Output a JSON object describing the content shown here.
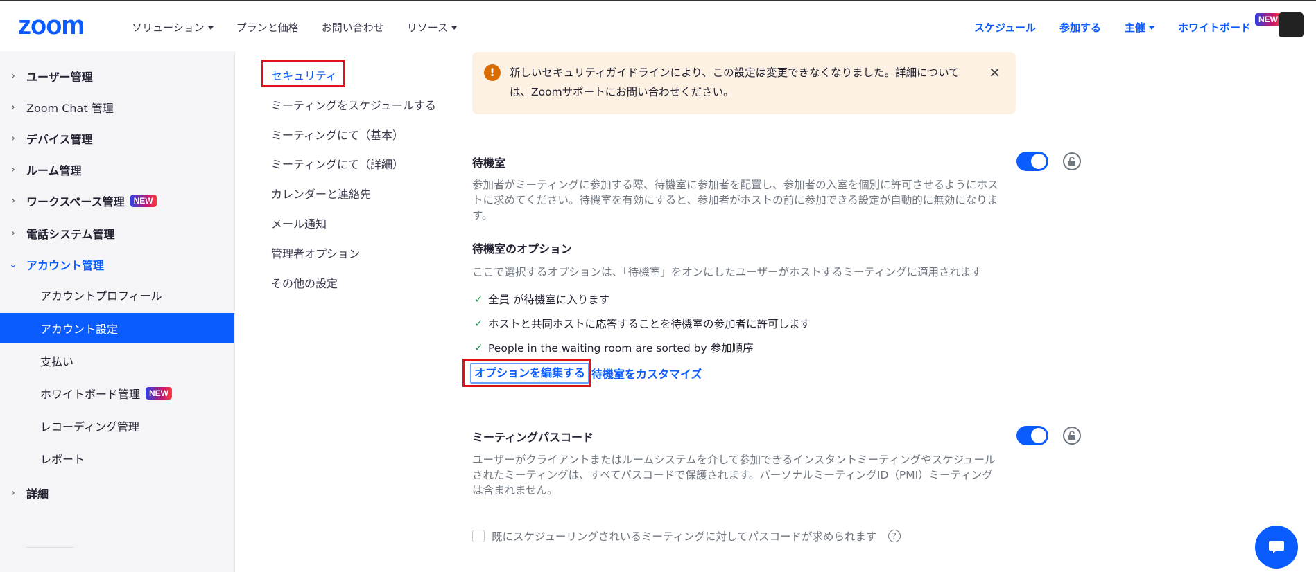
{
  "header": {
    "logo": "zoom",
    "nav_left": [
      {
        "label": "ソリューション",
        "has_caret": true
      },
      {
        "label": "プランと価格",
        "has_caret": false
      },
      {
        "label": "お問い合わせ",
        "has_caret": false
      },
      {
        "label": "リソース",
        "has_caret": true
      }
    ],
    "nav_right": {
      "schedule": "スケジュール",
      "join": "参加する",
      "host": "主催",
      "whiteboard": "ホワイトボード",
      "new_badge": "NEW"
    }
  },
  "sidebar": {
    "items": [
      {
        "label": "ユーザー管理"
      },
      {
        "label": "Zoom Chat 管理"
      },
      {
        "label": "デバイス管理"
      },
      {
        "label": "ルーム管理"
      },
      {
        "label": "ワークスペース管理",
        "badge": "NEW"
      },
      {
        "label": "電話システム管理"
      },
      {
        "label": "アカウント管理"
      }
    ],
    "subitems": [
      {
        "label": "アカウントプロフィール"
      },
      {
        "label": "アカウント設定"
      },
      {
        "label": "支払い"
      },
      {
        "label": "ホワイトボード管理",
        "badge": "NEW"
      },
      {
        "label": "レコーディング管理"
      },
      {
        "label": "レポート"
      }
    ],
    "advanced": "詳細"
  },
  "settings_nav": [
    "セキュリティ",
    "ミーティングをスケジュールする",
    "ミーティングにて（基本）",
    "ミーティングにて（詳細）",
    "カレンダーと連絡先",
    "メール通知",
    "管理者オプション",
    "その他の設定"
  ],
  "notice": {
    "message": "新しいセキュリティガイドラインにより、この設定は変更できなくなりました。詳細については、Zoomサポートにお問い合わせください。"
  },
  "waiting_room": {
    "title": "待機室",
    "description": "参加者がミーティングに参加する際、待機室に参加者を配置し、参加者の入室を個別に許可させるようにホストに求めてください。待機室を有効にすると、参加者がホストの前に参加できる設定が自動的に無効になります。",
    "enabled": true,
    "options_title": "待機室のオプション",
    "options_desc": "ここで選択するオプションは、「待機室」をオンにしたユーザーがホストするミーティングに適用されます",
    "options": [
      "全員 が待機室に入ります",
      "ホストと共同ホストに応答することを待機室の参加者に許可します",
      "People in the waiting room are sorted by 参加順序"
    ],
    "edit_options": "オプションを編集する",
    "customize": "待機室をカスタマイズ"
  },
  "meeting_passcode": {
    "title": "ミーティングパスコード",
    "description": "ユーザーがクライアントまたはルームシステムを介して参加できるインスタントミーティングやスケジュールされたミーティングは、すべてパスコードで保護されます。パーソナルミーティングID（PMI）ミーティングは含まれません。",
    "enabled": true,
    "checkbox_label": "既にスケジューリングされいるミーティングに対してパスコードが求められます",
    "help": "?"
  },
  "colors": {
    "accent": "#0b5cff",
    "highlight_box": "#e0131d",
    "notice_bg": "#fdf1e4",
    "warning": "#d96c00"
  }
}
